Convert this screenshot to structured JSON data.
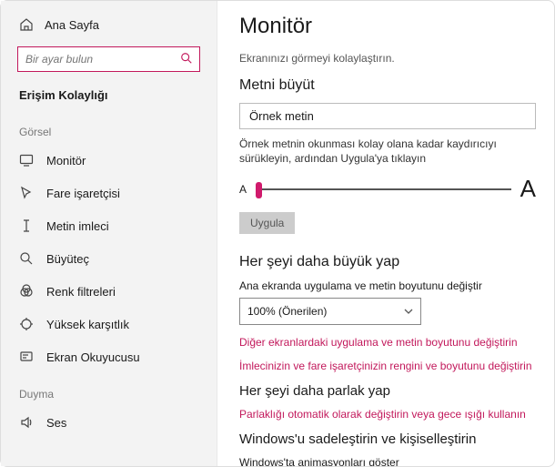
{
  "accent": "#c2185b",
  "sidebar": {
    "home": "Ana Sayfa",
    "search_placeholder": "Bir ayar bulun",
    "category": "Erişim Kolaylığı",
    "group1": "Görsel",
    "group2": "Duyma",
    "items": [
      {
        "label": "Monitör"
      },
      {
        "label": "Fare işaretçisi"
      },
      {
        "label": "Metin imleci"
      },
      {
        "label": "Büyüteç"
      },
      {
        "label": "Renk filtreleri"
      },
      {
        "label": "Yüksek karşıtlık"
      },
      {
        "label": "Ekran Okuyucusu"
      }
    ],
    "items2": [
      {
        "label": "Ses"
      }
    ]
  },
  "main": {
    "title": "Monitör",
    "desc": "Ekranınızı görmeyi kolaylaştırın.",
    "sec1": "Metni büyüt",
    "sample": "Örnek metin",
    "hint": "Örnek metnin okunması kolay olana kadar kaydırıcıyı sürükleyin, ardından Uygula'ya tıklayın",
    "slider_small": "A",
    "slider_big": "A",
    "apply": "Uygula",
    "sec2": "Her şeyi daha büyük yap",
    "scale_label": "Ana ekranda uygulama ve metin boyutunu değiştir",
    "scale_value": "100% (Önerilen)",
    "link1": "Diğer ekranlardaki uygulama ve metin boyutunu değiştirin",
    "link2": "İmlecinizin ve fare işaretçinizin rengini ve boyutunu değiştirin",
    "sec3": "Her şeyi daha parlak yap",
    "link3": "Parlaklığı otomatik olarak değiştirin veya gece ışığı kullanın",
    "sec4": "Windows'u sadeleştirin ve kişiselleştirin",
    "anim": "Windows'ta animasyonları göster"
  }
}
